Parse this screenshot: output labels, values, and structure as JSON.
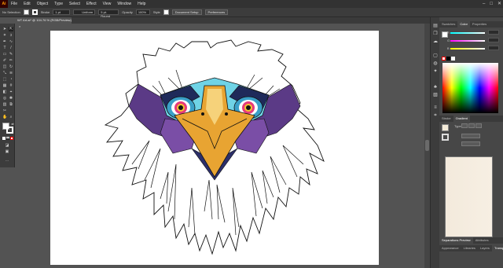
{
  "menubar": {
    "logo": "Ai",
    "items": [
      "File",
      "Edit",
      "Object",
      "Type",
      "Select",
      "Effect",
      "View",
      "Window",
      "Help"
    ],
    "window_controls": [
      "–",
      "□",
      "✕"
    ]
  },
  "control_bar": {
    "selection": "No Selection",
    "stroke_label": "Stroke",
    "stroke_value": "1 pt",
    "stroke_style": "Uniform",
    "brush": "5 pt. Round",
    "opacity_label": "Opacity",
    "opacity_value": "100%",
    "style_label": "Style",
    "document_setup": "Document Setup",
    "preferences": "Preferences"
  },
  "document_tab": {
    "title": "WT Art.ai* @ 104.76 % (RGB/Preview)",
    "close": "×"
  },
  "right_panel": {
    "top_tabs": [
      "Swatches",
      "Color",
      "Properties"
    ],
    "active_top_tab": "Color",
    "sliders": [
      "R",
      "G",
      "B"
    ],
    "middle_tabs": [
      "Stroke",
      "Gradient"
    ],
    "active_middle_tab": "Gradient",
    "type_label": "Type",
    "bottom_tabs_1": [
      "Separations Preview",
      "Attributes"
    ],
    "bottom_tabs_2": [
      "Appearance",
      "Libraries",
      "Layers",
      "Transparency"
    ]
  },
  "colors": {
    "accent_orange": "#ff9a00",
    "eagle_beak": "#e8a432",
    "eagle_cyan": "#6fd3e6",
    "eagle_purple": "#6b3e8f"
  }
}
